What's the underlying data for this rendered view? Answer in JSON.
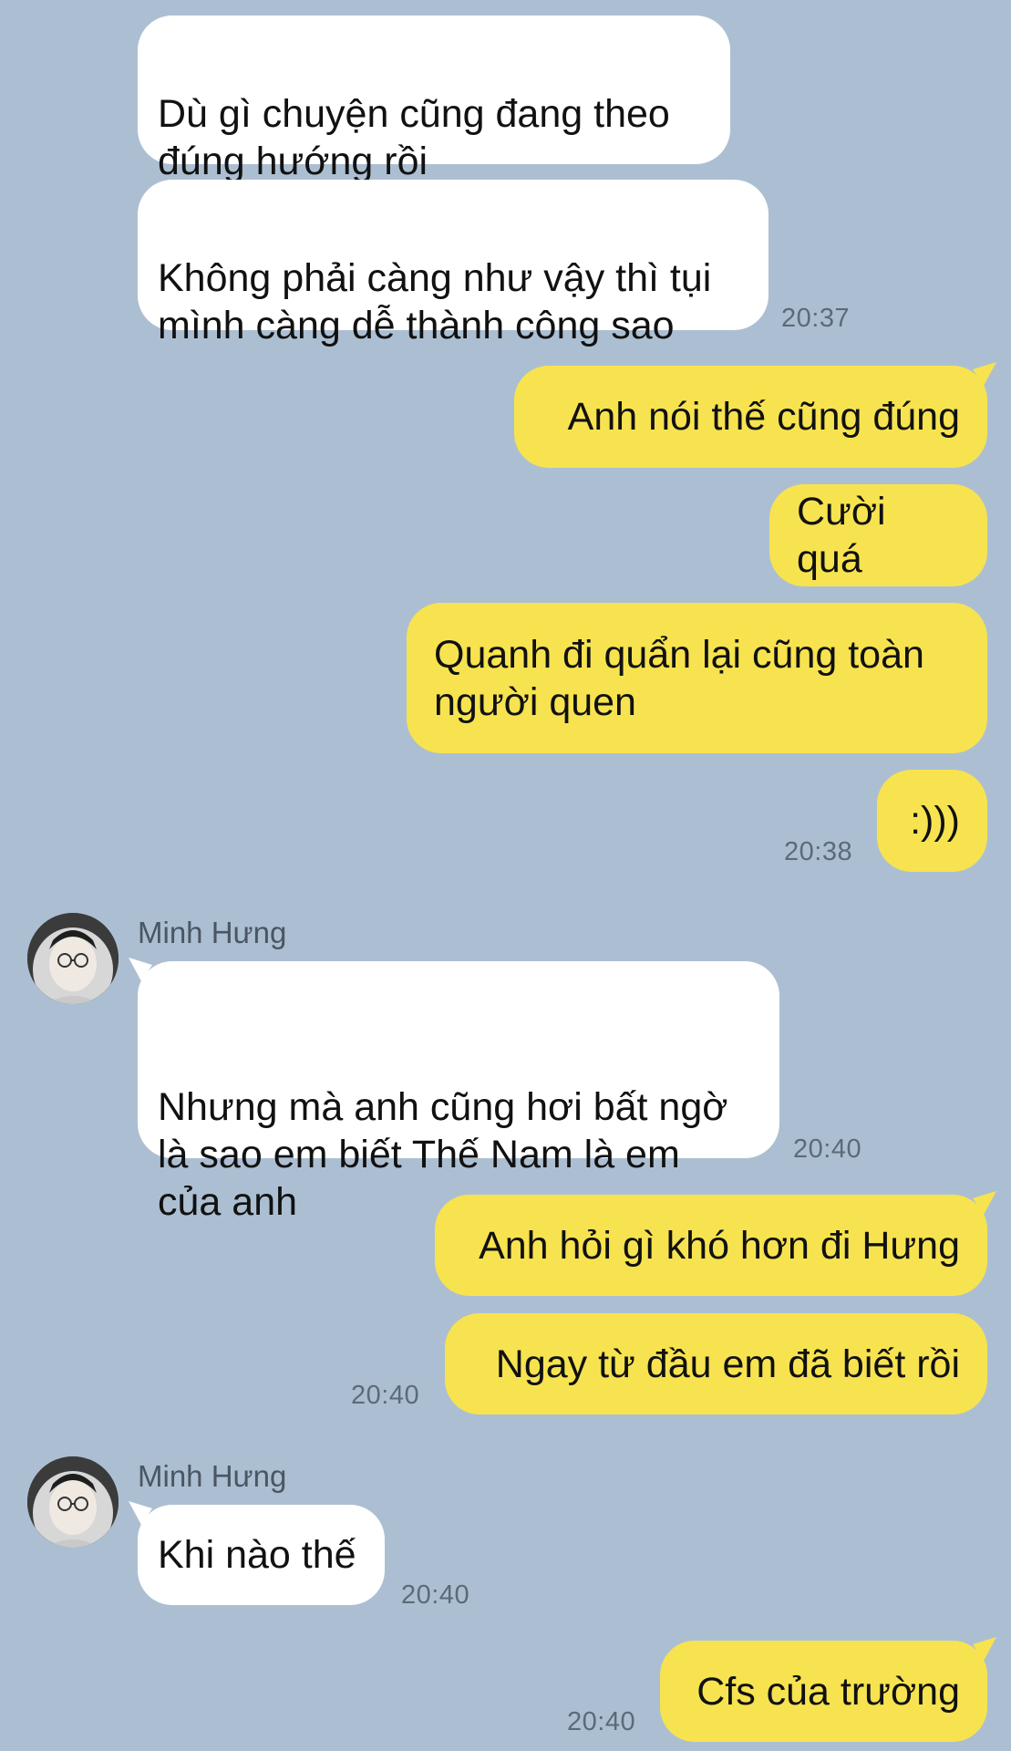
{
  "chat": {
    "colors": {
      "background": "#acbfd2",
      "sent_bubble": "#f7e34f",
      "received_bubble": "#ffffff",
      "timestamp": "#5c6a78"
    },
    "messages": [
      {
        "side": "received",
        "text": "Dù gì chuyện cũng đang theo\nđúng hướng rồi"
      },
      {
        "side": "received",
        "text": "Không phải càng như vậy thì tụi\nmình càng dễ thành công sao",
        "time": "20:37"
      },
      {
        "side": "sent",
        "text": "Anh nói thế cũng đúng"
      },
      {
        "side": "sent",
        "text": "Cười quá"
      },
      {
        "side": "sent",
        "text": "Quanh đi quẩn lại cũng toàn\nngười quen"
      },
      {
        "side": "sent",
        "text": ":)))",
        "time": "20:38"
      },
      {
        "side": "received",
        "sender": "Minh Hưng",
        "avatar_icon": "user-avatar-photo",
        "text": "Nhưng mà anh cũng hơi bất ngờ\nlà sao em biết Thế Nam là em\ncủa anh",
        "time": "20:40"
      },
      {
        "side": "sent",
        "text": "Anh hỏi gì khó hơn đi Hưng"
      },
      {
        "side": "sent",
        "text": "Ngay từ đầu em đã biết rồi",
        "time": "20:40"
      },
      {
        "side": "received",
        "sender": "Minh Hưng",
        "avatar_icon": "user-avatar-photo",
        "text": "Khi nào thế",
        "time": "20:40"
      },
      {
        "side": "sent",
        "text": "Cfs của trường",
        "time": "20:40"
      }
    ]
  }
}
